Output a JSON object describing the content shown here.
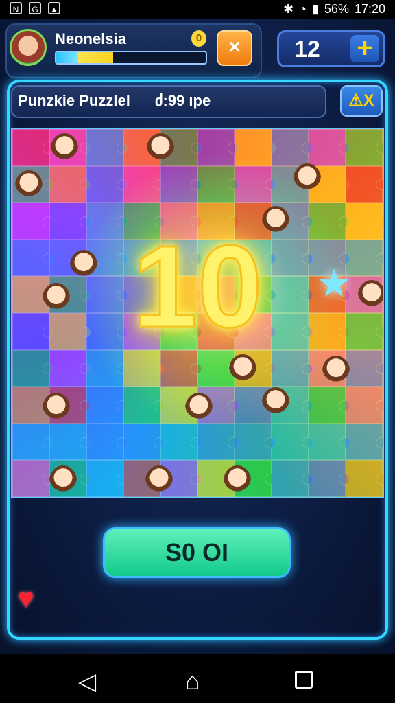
{
  "status_bar": {
    "battery_text": "56%",
    "time": "17:20"
  },
  "header": {
    "player_name": "Neonelsia",
    "coins": "0",
    "xp_progress": 0.38,
    "close_label": "×",
    "score": "12",
    "add_label": "+"
  },
  "puzzle": {
    "title": "Punzkie Puzzlel",
    "timer": "ძ:99 ıpe",
    "hint_label": "⚠X",
    "big_number": "10"
  },
  "action": {
    "button_label": "S0 OI"
  },
  "icons": {
    "heart": "heart-icon",
    "star": "star-icon",
    "back": "back-icon",
    "home": "home-icon",
    "recent": "recent-apps-icon"
  },
  "colors": {
    "frame_glow": "#37d6ff",
    "action_button": "#12c98b",
    "number_glow": "#fff36b"
  }
}
